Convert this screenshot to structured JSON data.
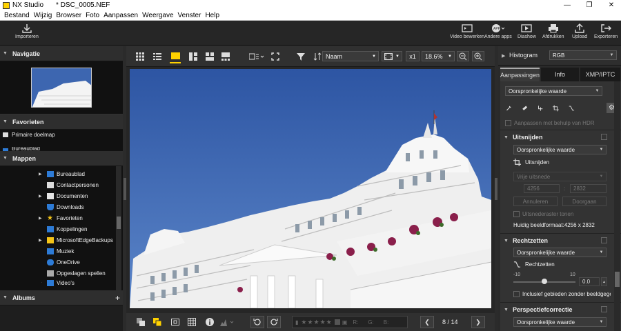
{
  "titlebar": {
    "app": "NX Studio",
    "file": "* DSC_0005.NEF"
  },
  "menu": [
    "Bestand",
    "Wijzig",
    "Browser",
    "Foto",
    "Aanpassen",
    "Weergave",
    "Venster",
    "Help"
  ],
  "toolbar": {
    "import": "Importeren",
    "video": "Video bewerken",
    "apps": "Andere apps",
    "slideshow": "Diashow",
    "print": "Afdrukken",
    "upload": "Upload",
    "export": "Exporteren"
  },
  "left": {
    "nav_title": "Navigatie",
    "fav_title": "Favorieten",
    "fav_items": [
      "Primaire doelmap",
      "Bureaublad"
    ],
    "folders_title": "Mappen",
    "folders": [
      "Bureaublad",
      "Contactpersonen",
      "Documenten",
      "Downloads",
      "Favorieten",
      "Koppelingen",
      "MicrosoftEdgeBackups",
      "Muziek",
      "OneDrive",
      "Opgeslagen spellen",
      "Video's"
    ],
    "albums_title": "Albums",
    "albums_add": "+"
  },
  "viewer": {
    "sort_label": "Naam",
    "zoom_mult": "x1",
    "zoom": "18.6%",
    "counter": "8 / 14",
    "r_label": "R:",
    "g_label": "G:",
    "b_label": "B:"
  },
  "right": {
    "histogram": "Histogram",
    "histo_channel": "RGB",
    "tabs": [
      "Aanpassingen",
      "Info",
      "XMP/IPTC"
    ],
    "preset": "Oorspronkelijke waarde",
    "hdr": "Aanpassen met behulp van HDR",
    "crop": {
      "title": "Uitsnijden",
      "preset": "Oorspronkelijke waarde",
      "label": "Uitsnijden",
      "ratio": "Vrije uitsnede",
      "w": "4256",
      "sep": ":",
      "h": "2832",
      "cancel": "Annuleren",
      "apply": "Doorgaan",
      "grid": "Uitsnederaster tonen",
      "size": "Huidig beeldformaat:4256 x 2832"
    },
    "straighten": {
      "title": "Rechtzetten",
      "preset": "Oorspronkelijke waarde",
      "label": "Rechtzetten",
      "min": "-10",
      "max": "10",
      "value": "0.0",
      "level": 0.5,
      "include": "Inclusief gebieden zonder beeldgegev"
    },
    "perspective": {
      "title": "Perspectiefcorrectie",
      "preset": "Oorspronkelijke waarde"
    }
  },
  "colors": {
    "accent": "#ffd200",
    "sky": "#3d66b0"
  }
}
